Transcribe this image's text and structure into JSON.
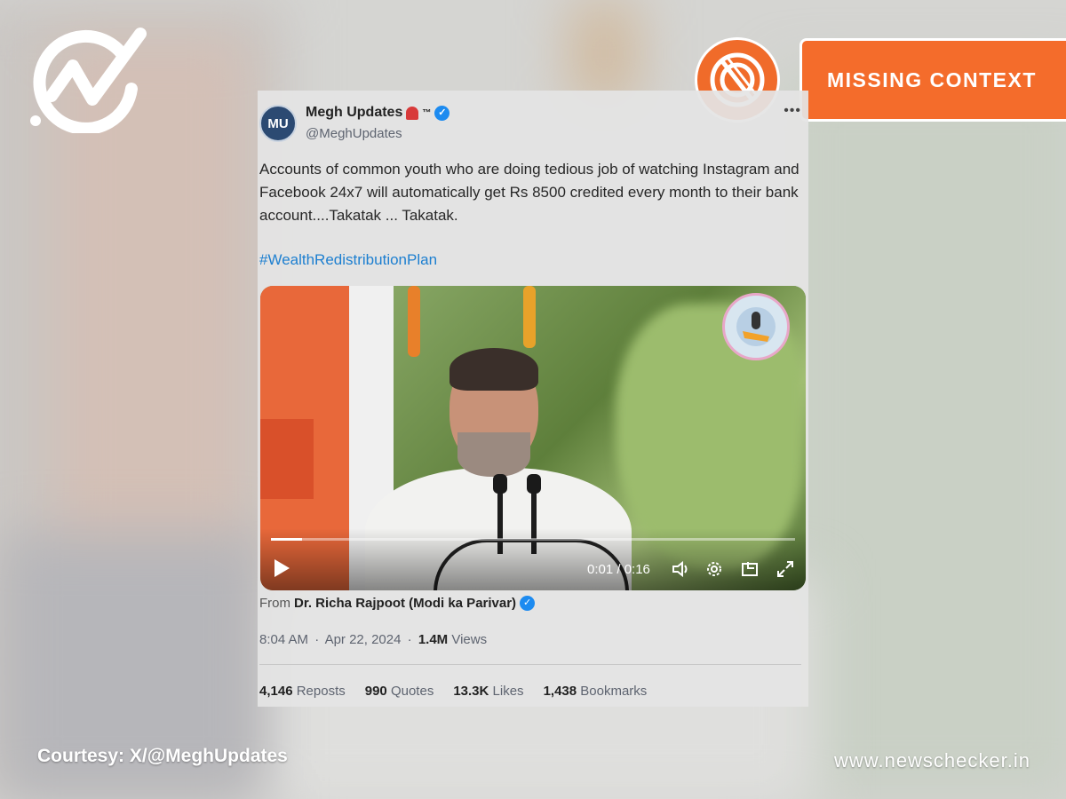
{
  "badge": {
    "label": "MISSING CONTEXT",
    "color": "#f46c2b"
  },
  "tweet": {
    "avatar_text": "MU",
    "display_name": "Megh Updates",
    "trademark": "™",
    "handle": "@MeghUpdates",
    "more_icon": "more-icon",
    "text": "Accounts of common youth who are doing tedious job of watching Instagram and Facebook 24x7 will automatically get Rs 8500 credited every month to their bank account....Takatak ... Takatak.",
    "hashtag": "#WealthRedistributionPlan",
    "video": {
      "current_time": "0:01",
      "duration": "0:16",
      "time_display": "0:01 / 0:16",
      "progress": 0.06
    },
    "from_label": "From",
    "from_name": "Dr. Richa Rajpoot (Modi ka Parivar)",
    "time": "8:04 AM",
    "date": "Apr 22, 2024",
    "separator": "·",
    "views_count": "1.4M",
    "views_label": "Views",
    "stats": {
      "reposts_count": "4,146",
      "reposts_label": "Reposts",
      "quotes_count": "990",
      "quotes_label": "Quotes",
      "likes_count": "13.3K",
      "likes_label": "Likes",
      "bookmarks_count": "1,438",
      "bookmarks_label": "Bookmarks"
    }
  },
  "footer": {
    "courtesy": "Courtesy: X/@MeghUpdates",
    "site": "www.newschecker.in"
  },
  "colors": {
    "accent": "#f46c2b",
    "link": "#1d7fd0",
    "verified": "#1d8bf0"
  }
}
